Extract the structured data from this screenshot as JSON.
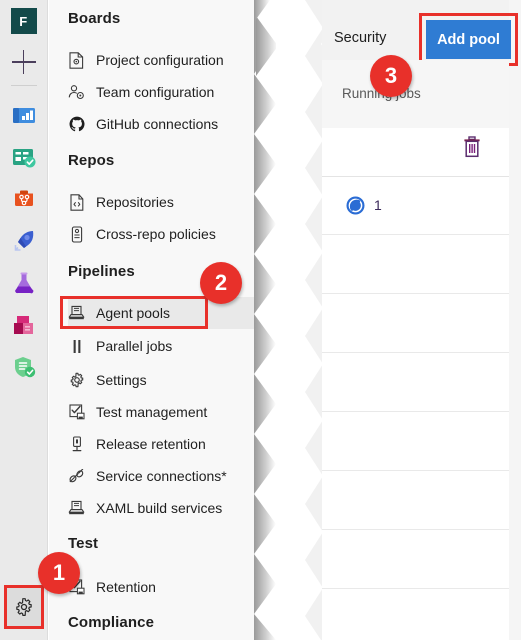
{
  "colors": {
    "accent_blue": "#2f7cd3",
    "callout_red": "#e8302a",
    "sidebar_bg": "#f8f8f8",
    "rail_bg": "#eaeaea",
    "selected_item_bg": "#e9e9e9",
    "panel_header_bg": "#f2f2f2"
  },
  "rail": {
    "org_logo_letter": "F",
    "new_item_icon": "plus-icon",
    "products": [
      {
        "name": "overview-icon"
      },
      {
        "name": "boards-icon"
      },
      {
        "name": "repos-icon"
      },
      {
        "name": "pipelines-icon"
      },
      {
        "name": "test-plans-icon"
      },
      {
        "name": "artifacts-icon"
      },
      {
        "name": "advanced-security-icon"
      }
    ],
    "settings": {
      "icon": "gear-icon",
      "highlighted": true
    }
  },
  "sidebar": {
    "sections": [
      {
        "title": "Boards",
        "items": [
          {
            "label": "Project configuration",
            "icon": "document-gear-icon"
          },
          {
            "label": "Team configuration",
            "icon": "people-gear-icon"
          },
          {
            "label": "GitHub connections",
            "icon": "github-icon"
          }
        ]
      },
      {
        "title": "Repos",
        "items": [
          {
            "label": "Repositories",
            "icon": "repository-icon"
          },
          {
            "label": "Cross-repo policies",
            "icon": "policy-icon"
          }
        ]
      },
      {
        "title": "Pipelines",
        "items": [
          {
            "label": "Agent pools",
            "icon": "agent-server-icon",
            "selected": true
          },
          {
            "label": "Parallel jobs",
            "icon": "parallel-bars-icon"
          },
          {
            "label": "Settings",
            "icon": "gear-icon"
          },
          {
            "label": "Test management",
            "icon": "test-management-icon"
          },
          {
            "label": "Release retention",
            "icon": "release-retention-icon"
          },
          {
            "label": "Service connections*",
            "icon": "plug-connection-icon"
          },
          {
            "label": "XAML build services",
            "icon": "agent-server-icon"
          }
        ]
      },
      {
        "title": "Test",
        "items": [
          {
            "label": "Retention",
            "icon": "test-management-icon"
          }
        ]
      },
      {
        "title": "Compliance",
        "items": []
      }
    ]
  },
  "panel": {
    "tab_label": "Security",
    "add_pool_label": "Add pool",
    "column_header": "Running jobs",
    "delete_icon": "trash-icon",
    "rows": [
      {
        "icon": "hosted-pool-globe-icon",
        "running_jobs": "1"
      },
      {
        "icon": "",
        "running_jobs": ""
      },
      {
        "icon": "",
        "running_jobs": ""
      },
      {
        "icon": "",
        "running_jobs": ""
      },
      {
        "icon": "",
        "running_jobs": ""
      },
      {
        "icon": "",
        "running_jobs": ""
      },
      {
        "icon": "",
        "running_jobs": ""
      },
      {
        "icon": "",
        "running_jobs": ""
      }
    ]
  },
  "callouts": [
    {
      "number": "1",
      "target": "project-settings-gear"
    },
    {
      "number": "2",
      "target": "agent-pools-nav-item"
    },
    {
      "number": "3",
      "target": "add-pool-button"
    }
  ]
}
